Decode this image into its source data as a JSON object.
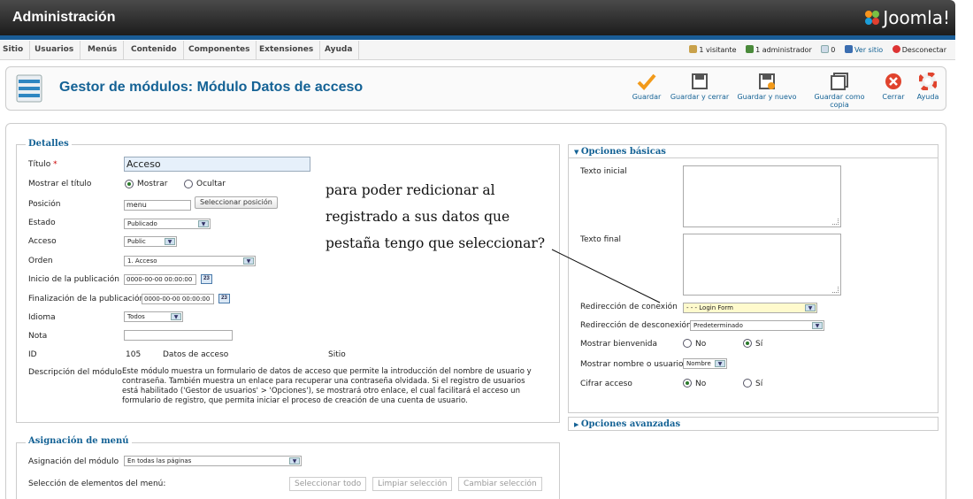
{
  "header": {
    "app_title": "Administración",
    "logo_text": "Joomla!"
  },
  "menu": {
    "items": [
      "Sitio",
      "Usuarios",
      "Menús",
      "Contenido",
      "Componentes",
      "Extensiones",
      "Ayuda"
    ]
  },
  "status": {
    "visitors": "1 visitante",
    "admins": "1 administrador",
    "messages": "0",
    "view_site": "Ver sitio",
    "logout": "Desconectar"
  },
  "toolbar": {
    "page_title": "Gestor de módulos: Módulo Datos de acceso",
    "buttons": {
      "save": "Guardar",
      "save_close": "Guardar y cerrar",
      "save_new": "Guardar y nuevo",
      "save_copy": "Guardar como copia",
      "close": "Cerrar",
      "help": "Ayuda"
    }
  },
  "details": {
    "legend": "Detalles",
    "title_label": "Título",
    "required_mark": "*",
    "title_value": "Acceso",
    "show_title_label": "Mostrar el título",
    "show_option": "Mostrar",
    "hide_option": "Ocultar",
    "position_label": "Posición",
    "position_value": "menu",
    "select_position_button": "Seleccionar posición",
    "state_label": "Estado",
    "state_value": "Publicado",
    "access_label": "Acceso",
    "access_value": "Public",
    "order_label": "Orden",
    "order_value": "1. Acceso",
    "publish_start_label": "Inicio de la publicación",
    "publish_start_value": "0000-00-00 00:00:00",
    "publish_end_label": "Finalización de la publicación",
    "publish_end_value": "0000-00-00 00:00:00",
    "calendar_icon_text": "23",
    "language_label": "Idioma",
    "language_value": "Todos",
    "note_label": "Nota",
    "note_value": "",
    "id_label": "ID",
    "id_value": "105",
    "module_name": "Datos de acceso",
    "client": "Sitio",
    "description_label": "Descripción del módulo",
    "description_lines": [
      "Este módulo muestra un formulario de datos de acceso que permite la introducción del nombre de usuario y",
      "contraseña. También muestra un enlace para recuperar una contraseña olvidada. Si el registro de usuarios",
      "está habilitado ('Gestor de usuarios' > 'Opciones'), se mostrará otro enlace, el cual facilitará el acceso un",
      "formulario de registro, que permita iniciar el proceso de creación de una cuenta de usuario."
    ]
  },
  "menu_assignment": {
    "legend": "Asignación de menú",
    "assignment_label": "Asignación del módulo",
    "assignment_value": "En todas las páginas",
    "items_label": "Selección de elementos del menú:",
    "select_all": "Seleccionar todo",
    "clear_selection": "Limpiar selección",
    "toggle_selection": "Cambiar selección"
  },
  "basic_options": {
    "header": "Opciones básicas",
    "pretext_label": "Texto inicial",
    "posttext_label": "Texto final",
    "login_redirect_label": "Redirección de conexión",
    "login_redirect_value": "- - - Login Form",
    "logout_redirect_label": "Redirección de desconexión",
    "logout_redirect_value": "Predeterminado",
    "greeting_label": "Mostrar bienvenida",
    "name_label": "Mostrar nombre o usuario",
    "name_value": "Nombre",
    "encrypt_label": "Cifrar acceso",
    "no_option": "No",
    "yes_option": "Sí"
  },
  "advanced_options": {
    "header": "Opciones avanzadas"
  },
  "annotation": {
    "lines": [
      "para poder redicionar al",
      "registrado a sus datos que",
      "pestaña tengo que seleccionar?"
    ]
  },
  "colors": {
    "accent_blue": "#146295",
    "header_dark": "#2b2b2b",
    "strip_blue": "#1a5d97"
  }
}
